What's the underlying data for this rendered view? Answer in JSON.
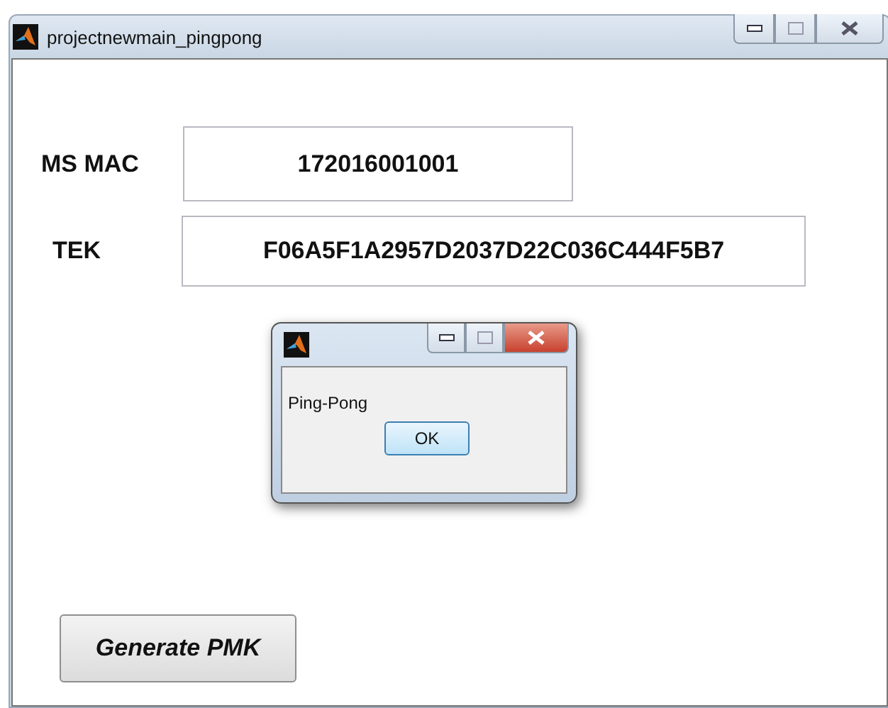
{
  "window": {
    "title": "projectnewmain_pingpong"
  },
  "fields": [
    {
      "label": "MS MAC",
      "value": "172016001001"
    },
    {
      "label": "TEK",
      "value": "F06A5F1A2957D2037D22C036C444F5B7"
    }
  ],
  "dialog": {
    "message": "Ping-Pong",
    "button": "OK"
  },
  "button": "Generate  PMK"
}
